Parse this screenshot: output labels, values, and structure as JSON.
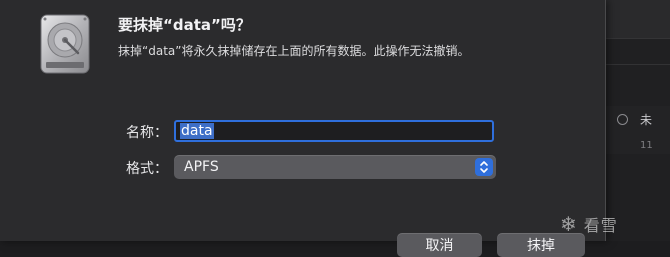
{
  "dialog": {
    "title": "要抹掉“data”吗？",
    "message": "抹掉“data”将永久抹掉储存在上面的所有数据。此操作无法撤销。",
    "name_label": "名称：",
    "name_value": "data",
    "format_label": "格式：",
    "format_value": "APFS",
    "cancel_label": "取消",
    "erase_label": "抹掉",
    "icon": "hard-disk-icon"
  },
  "background": {
    "row_text": "未",
    "row_subtext": "11"
  },
  "watermark": {
    "text": "看雪",
    "icon": "snowflake-icon"
  },
  "colors": {
    "accent": "#2f6fdc",
    "sheet_bg": "#2b2b2d",
    "button_bg": "#5a5a5e"
  }
}
